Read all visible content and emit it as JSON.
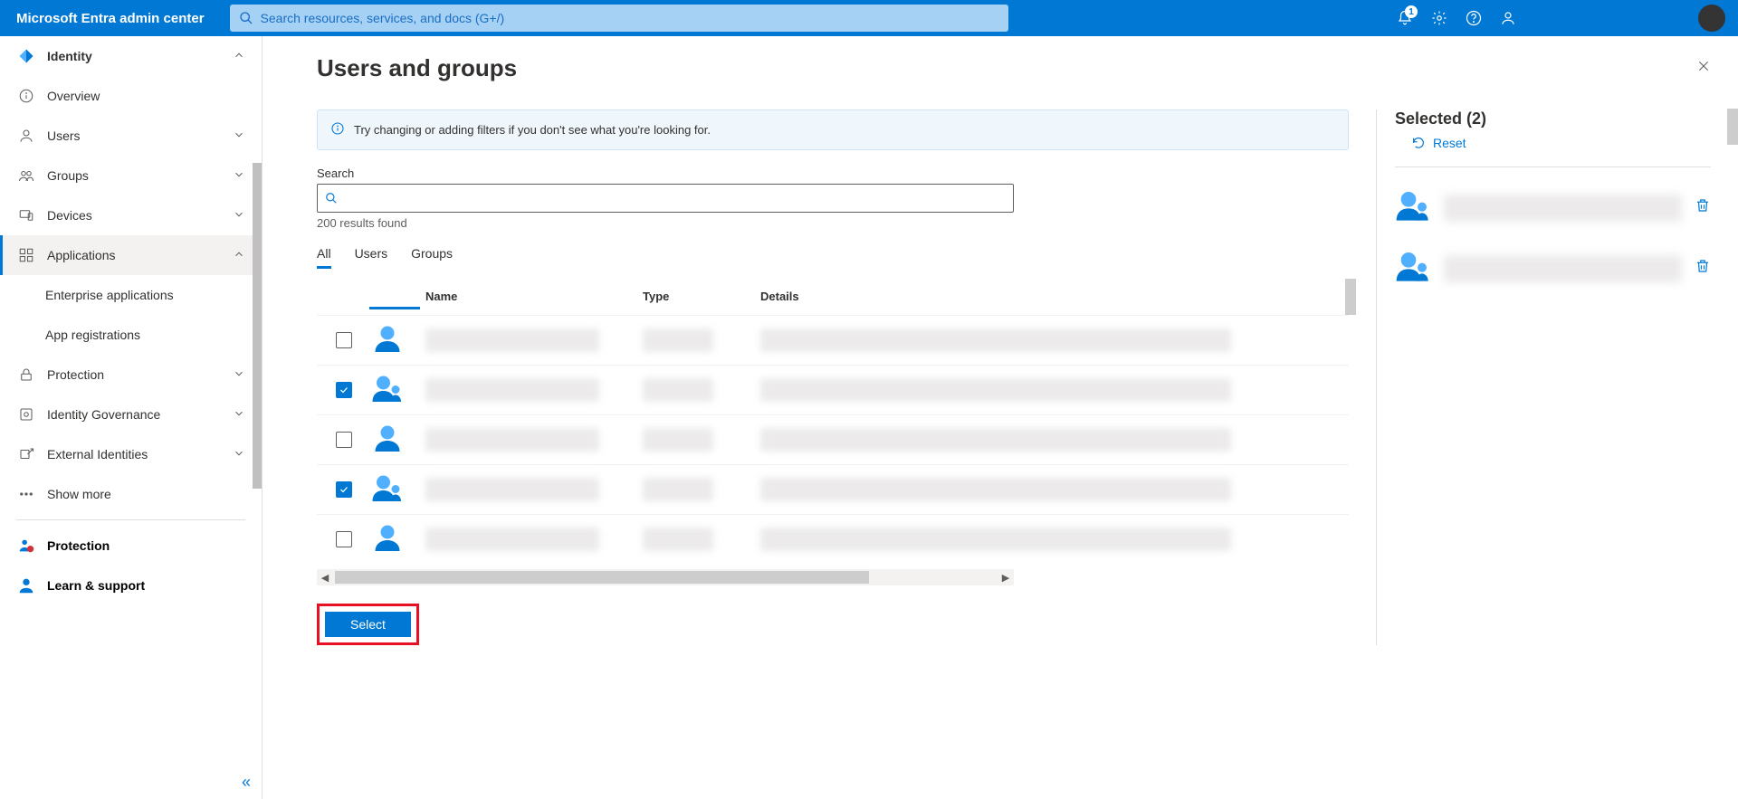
{
  "topbar": {
    "title": "Microsoft Entra admin center",
    "search_placeholder": "Search resources, services, and docs (G+/)",
    "notification_count": "1"
  },
  "sidebar": {
    "items": [
      {
        "label": "Identity",
        "expanded": true
      },
      {
        "label": "Overview"
      },
      {
        "label": "Users"
      },
      {
        "label": "Groups"
      },
      {
        "label": "Devices"
      },
      {
        "label": "Applications",
        "expanded": true,
        "selected": true
      },
      {
        "label": "Enterprise applications"
      },
      {
        "label": "App registrations"
      },
      {
        "label": "Protection"
      },
      {
        "label": "Identity Governance"
      },
      {
        "label": "External Identities"
      },
      {
        "label": "Show more"
      }
    ],
    "bottom": {
      "protection": "Protection",
      "learn": "Learn & support"
    }
  },
  "page": {
    "title": "Users and groups",
    "banner": "Try changing or adding filters if you don't see what you're looking for.",
    "search_label": "Search",
    "results_text": "200 results found",
    "tabs": {
      "all": "All",
      "users": "Users",
      "groups": "Groups"
    },
    "columns": {
      "name": "Name",
      "type": "Type",
      "details": "Details"
    },
    "rows": [
      {
        "checked": false,
        "variant": "user"
      },
      {
        "checked": true,
        "variant": "group"
      },
      {
        "checked": false,
        "variant": "user"
      },
      {
        "checked": true,
        "variant": "group"
      },
      {
        "checked": false,
        "variant": "user"
      }
    ],
    "select_button": "Select"
  },
  "selected": {
    "title": "Selected (2)",
    "reset": "Reset",
    "items": [
      {},
      {}
    ]
  }
}
